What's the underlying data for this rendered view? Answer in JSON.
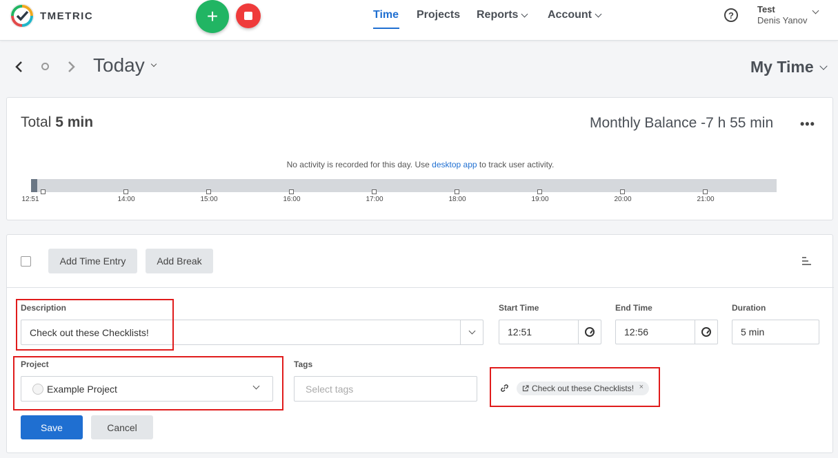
{
  "header": {
    "brand": "TMETRIC",
    "nav": [
      {
        "label": "Time"
      },
      {
        "label": "Projects"
      },
      {
        "label": "Reports"
      },
      {
        "label": "Account"
      }
    ],
    "help_glyph": "?",
    "user": {
      "team": "Test",
      "name": "Denis Yanov"
    }
  },
  "date_nav": {
    "title": "Today",
    "view": "My Time"
  },
  "summary": {
    "total_label": "Total",
    "total_value": "5 min",
    "balance": "Monthly Balance -7 h 55 min",
    "more_glyph": "•••",
    "no_activity_prefix": "No activity is recorded for this day. Use",
    "no_activity_link": "desktop app",
    "no_activity_suffix": "to track user activity.",
    "timeline_labels": [
      "12:51",
      "14:00",
      "15:00",
      "16:00",
      "17:00",
      "18:00",
      "19:00",
      "20:00",
      "21:00"
    ]
  },
  "entries": {
    "add_time_entry": "Add Time Entry",
    "add_break": "Add Break"
  },
  "form": {
    "description_label": "Description",
    "description_value": "Check out these Checklists!",
    "start_label": "Start Time",
    "start_value": "12:51",
    "end_label": "End Time",
    "end_value": "12:56",
    "duration_label": "Duration",
    "duration_value": "5 min",
    "project_label": "Project",
    "project_value": "Example Project",
    "tags_label": "Tags",
    "tags_placeholder": "Select tags",
    "task_chip": "Check out these Checklists!",
    "save": "Save",
    "cancel": "Cancel"
  },
  "colors": {
    "accent": "#1f6fd1",
    "add_button": "#21b563",
    "stop_button": "#ef3b3b",
    "highlight": "#e01b1b"
  }
}
